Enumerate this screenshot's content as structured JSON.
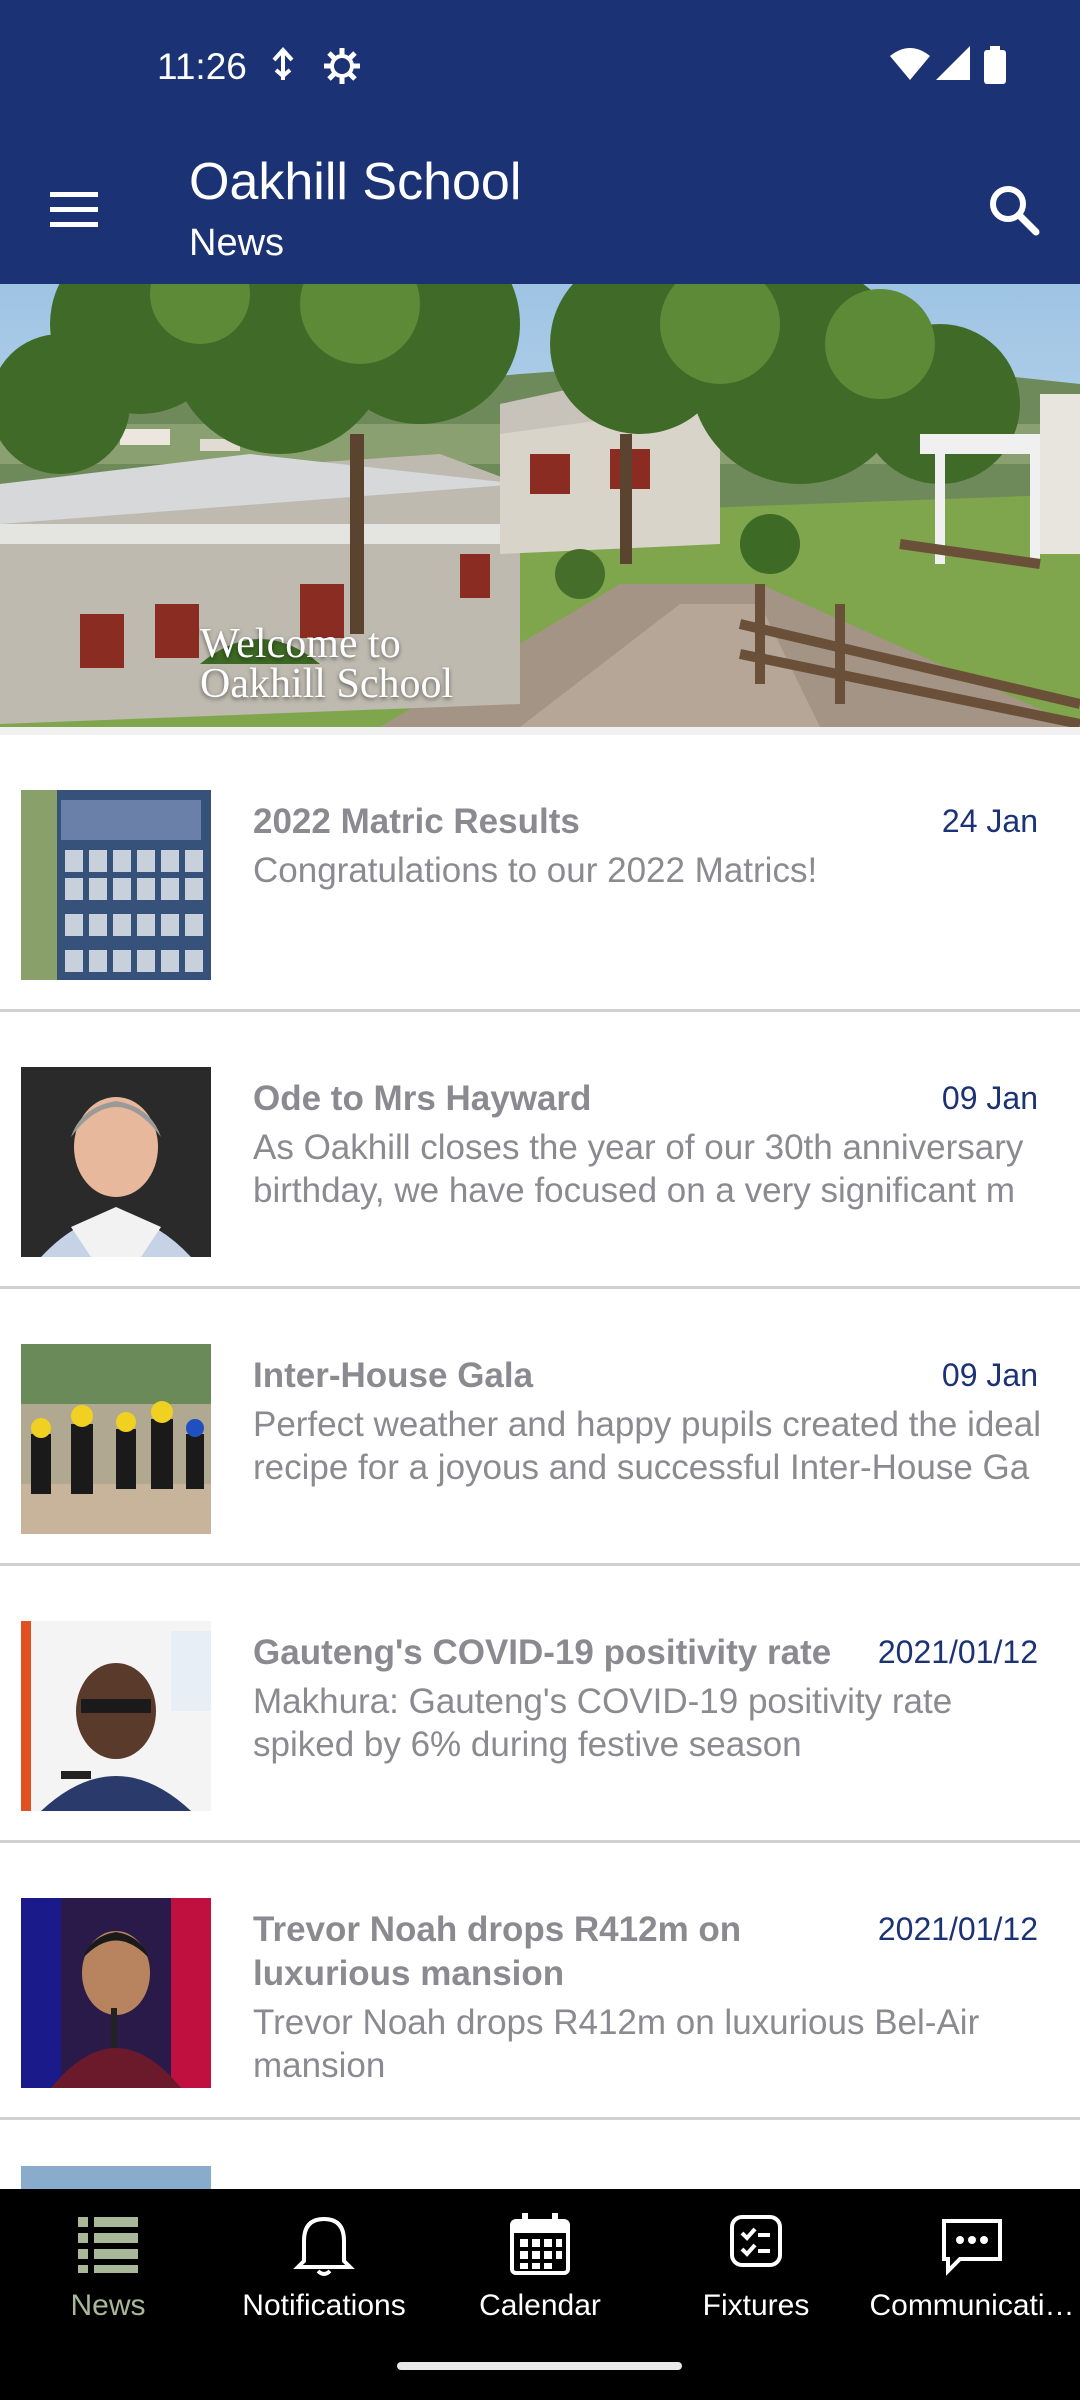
{
  "status_bar": {
    "time": "11:26"
  },
  "app_bar": {
    "title": "Oakhill School",
    "subtitle": "News"
  },
  "hero": {
    "line1": "Welcome to",
    "line2": "Oakhill School"
  },
  "news": [
    {
      "title": "2022 Matric Results",
      "date": "24 Jan",
      "description": "Congratulations to our 2022 Matrics!"
    },
    {
      "title": "Ode to Mrs Hayward",
      "date": "09 Jan",
      "description": "As Oakhill closes the year of our 30th anniversary birthday, we have focused on a very significant m"
    },
    {
      "title": "Inter-House Gala",
      "date": "09 Jan",
      "description": "Perfect weather and happy pupils created the ideal recipe for a joyous and successful Inter-House Ga"
    },
    {
      "title": "Gauteng's COVID-19 positivity rate",
      "date": "2021/01/12",
      "description": "Makhura: Gauteng's COVID-19 positivity rate spiked by 6% during festive season"
    },
    {
      "title": "Trevor Noah drops R412m on luxurious mansion",
      "date": "2021/01/12",
      "description": "Trevor Noah drops R412m on luxurious Bel-Air mansion"
    }
  ],
  "bottom_nav": [
    {
      "label": "News",
      "icon": "list-icon",
      "active": true
    },
    {
      "label": "Notifications",
      "icon": "bell-icon",
      "active": false
    },
    {
      "label": "Calendar",
      "icon": "calendar-icon",
      "active": false
    },
    {
      "label": "Fixtures",
      "icon": "checklist-icon",
      "active": false
    },
    {
      "label": "Communicati…",
      "icon": "chat-icon",
      "active": false
    }
  ],
  "colors": {
    "primary": "#1b3275",
    "muted_text": "#8a8a90",
    "nav_background": "#000000",
    "active_nav": "#a8b898"
  }
}
